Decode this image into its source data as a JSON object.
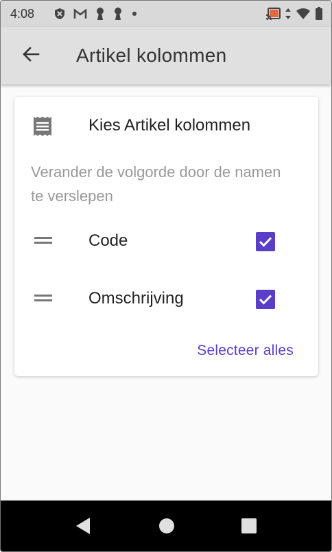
{
  "status_bar": {
    "time": "4:08",
    "left_icons": [
      "shield-icon",
      "gmail-icon",
      "keyhole-icon",
      "keyhole-icon",
      "dot-icon"
    ],
    "right_icons": [
      "cast-icon",
      "data-arrows-icon",
      "wifi-icon",
      "battery-icon"
    ]
  },
  "app_bar": {
    "back_icon": "arrow-back-icon",
    "title": "Artikel kolommen"
  },
  "card": {
    "icon": "receipt-icon",
    "title": "Kies Artikel kolommen",
    "helper": "Verander de volgorde door de namen te verslepen",
    "rows": [
      {
        "label": "Code",
        "checked": true
      },
      {
        "label": "Omschrijving",
        "checked": true
      }
    ],
    "select_all_label": "Selecteer alles"
  },
  "colors": {
    "accent": "#5b3ec8",
    "appbar": "#e0e0e0",
    "statusbar": "#d9d9d9",
    "background": "#fafafa"
  },
  "nav_bar": {
    "buttons": [
      "back-triangle-icon",
      "home-circle-icon",
      "recents-square-icon"
    ]
  }
}
